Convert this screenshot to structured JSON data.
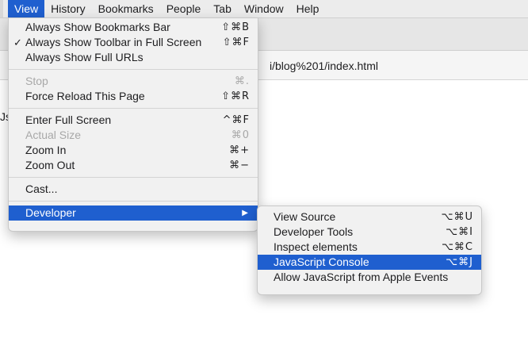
{
  "menubar": {
    "items": [
      "View",
      "History",
      "Bookmarks",
      "People",
      "Tab",
      "Window",
      "Help"
    ],
    "active_index": 0
  },
  "toolbar": {
    "url_left_fragment": "Js",
    "url_right_fragment": "i/blog%201/index.html"
  },
  "view_menu": {
    "always_show_bookmarks_bar": {
      "label": "Always Show Bookmarks Bar",
      "shortcut": "⇧⌘B"
    },
    "always_show_toolbar": {
      "label": "Always Show Toolbar in Full Screen",
      "shortcut": "⇧⌘F",
      "check": "✓"
    },
    "always_show_full_urls": {
      "label": "Always Show Full URLs"
    },
    "stop": {
      "label": "Stop",
      "shortcut": "⌘."
    },
    "force_reload": {
      "label": "Force Reload This Page",
      "shortcut": "⇧⌘R"
    },
    "enter_full_screen": {
      "label": "Enter Full Screen",
      "shortcut": "^⌘F"
    },
    "actual_size": {
      "label": "Actual Size",
      "shortcut": "⌘0"
    },
    "zoom_in": {
      "label": "Zoom In",
      "shortcut": "⌘+"
    },
    "zoom_out": {
      "label": "Zoom Out",
      "shortcut": "⌘−"
    },
    "cast": {
      "label": "Cast..."
    },
    "developer": {
      "label": "Developer",
      "arrow": "▶"
    }
  },
  "developer_menu": {
    "view_source": {
      "label": "View Source",
      "shortcut": "⌥⌘U"
    },
    "developer_tools": {
      "label": "Developer Tools",
      "shortcut": "⌥⌘I"
    },
    "inspect_elements": {
      "label": "Inspect elements",
      "shortcut": "⌥⌘C"
    },
    "javascript_console": {
      "label": "JavaScript Console",
      "shortcut": "⌥⌘J"
    },
    "allow_js_apple_events": {
      "label": "Allow JavaScript from Apple Events"
    }
  },
  "colors": {
    "accent": "#1f5fcf",
    "menu_bg": "#f1f1f1",
    "disabled_text": "#a8a8a8"
  }
}
